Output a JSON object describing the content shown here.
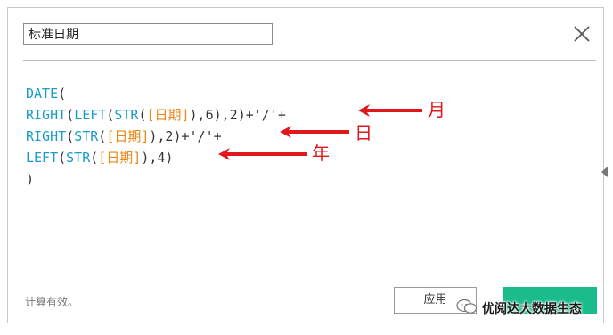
{
  "dialog": {
    "name_value": "标准日期",
    "close_icon": "close-x-icon"
  },
  "formula": {
    "line1": {
      "fn": "DATE",
      "open": "("
    },
    "line2": {
      "fn1": "RIGHT",
      "p1": "(",
      "fn2": "LEFT",
      "p2": "(",
      "fn3": "STR",
      "p3": "(",
      "field": "[日期]",
      "tail": "),6),2)+'/'+"
    },
    "line3": {
      "fn1": "RIGHT",
      "p1": "(",
      "fn2": "STR",
      "p2": "(",
      "field": "[日期]",
      "tail": "),2)+'/'+"
    },
    "line4": {
      "fn1": "LEFT",
      "p1": "(",
      "fn2": "STR",
      "p2": "(",
      "field": "[日期]",
      "tail": "),4)"
    },
    "line5": {
      "close": ")"
    }
  },
  "annotations": {
    "month": "月",
    "day": "日",
    "year": "年",
    "color": "#e0171b"
  },
  "status_text": "计算有效。",
  "buttons": {
    "apply_label": "应用"
  },
  "watermark": {
    "text": "优阅达大数据生态",
    "icon": "wechat-icon"
  },
  "colors": {
    "keyword": "#1a9cc4",
    "field": "#e8891a",
    "ok_button": "#1abc8c"
  }
}
